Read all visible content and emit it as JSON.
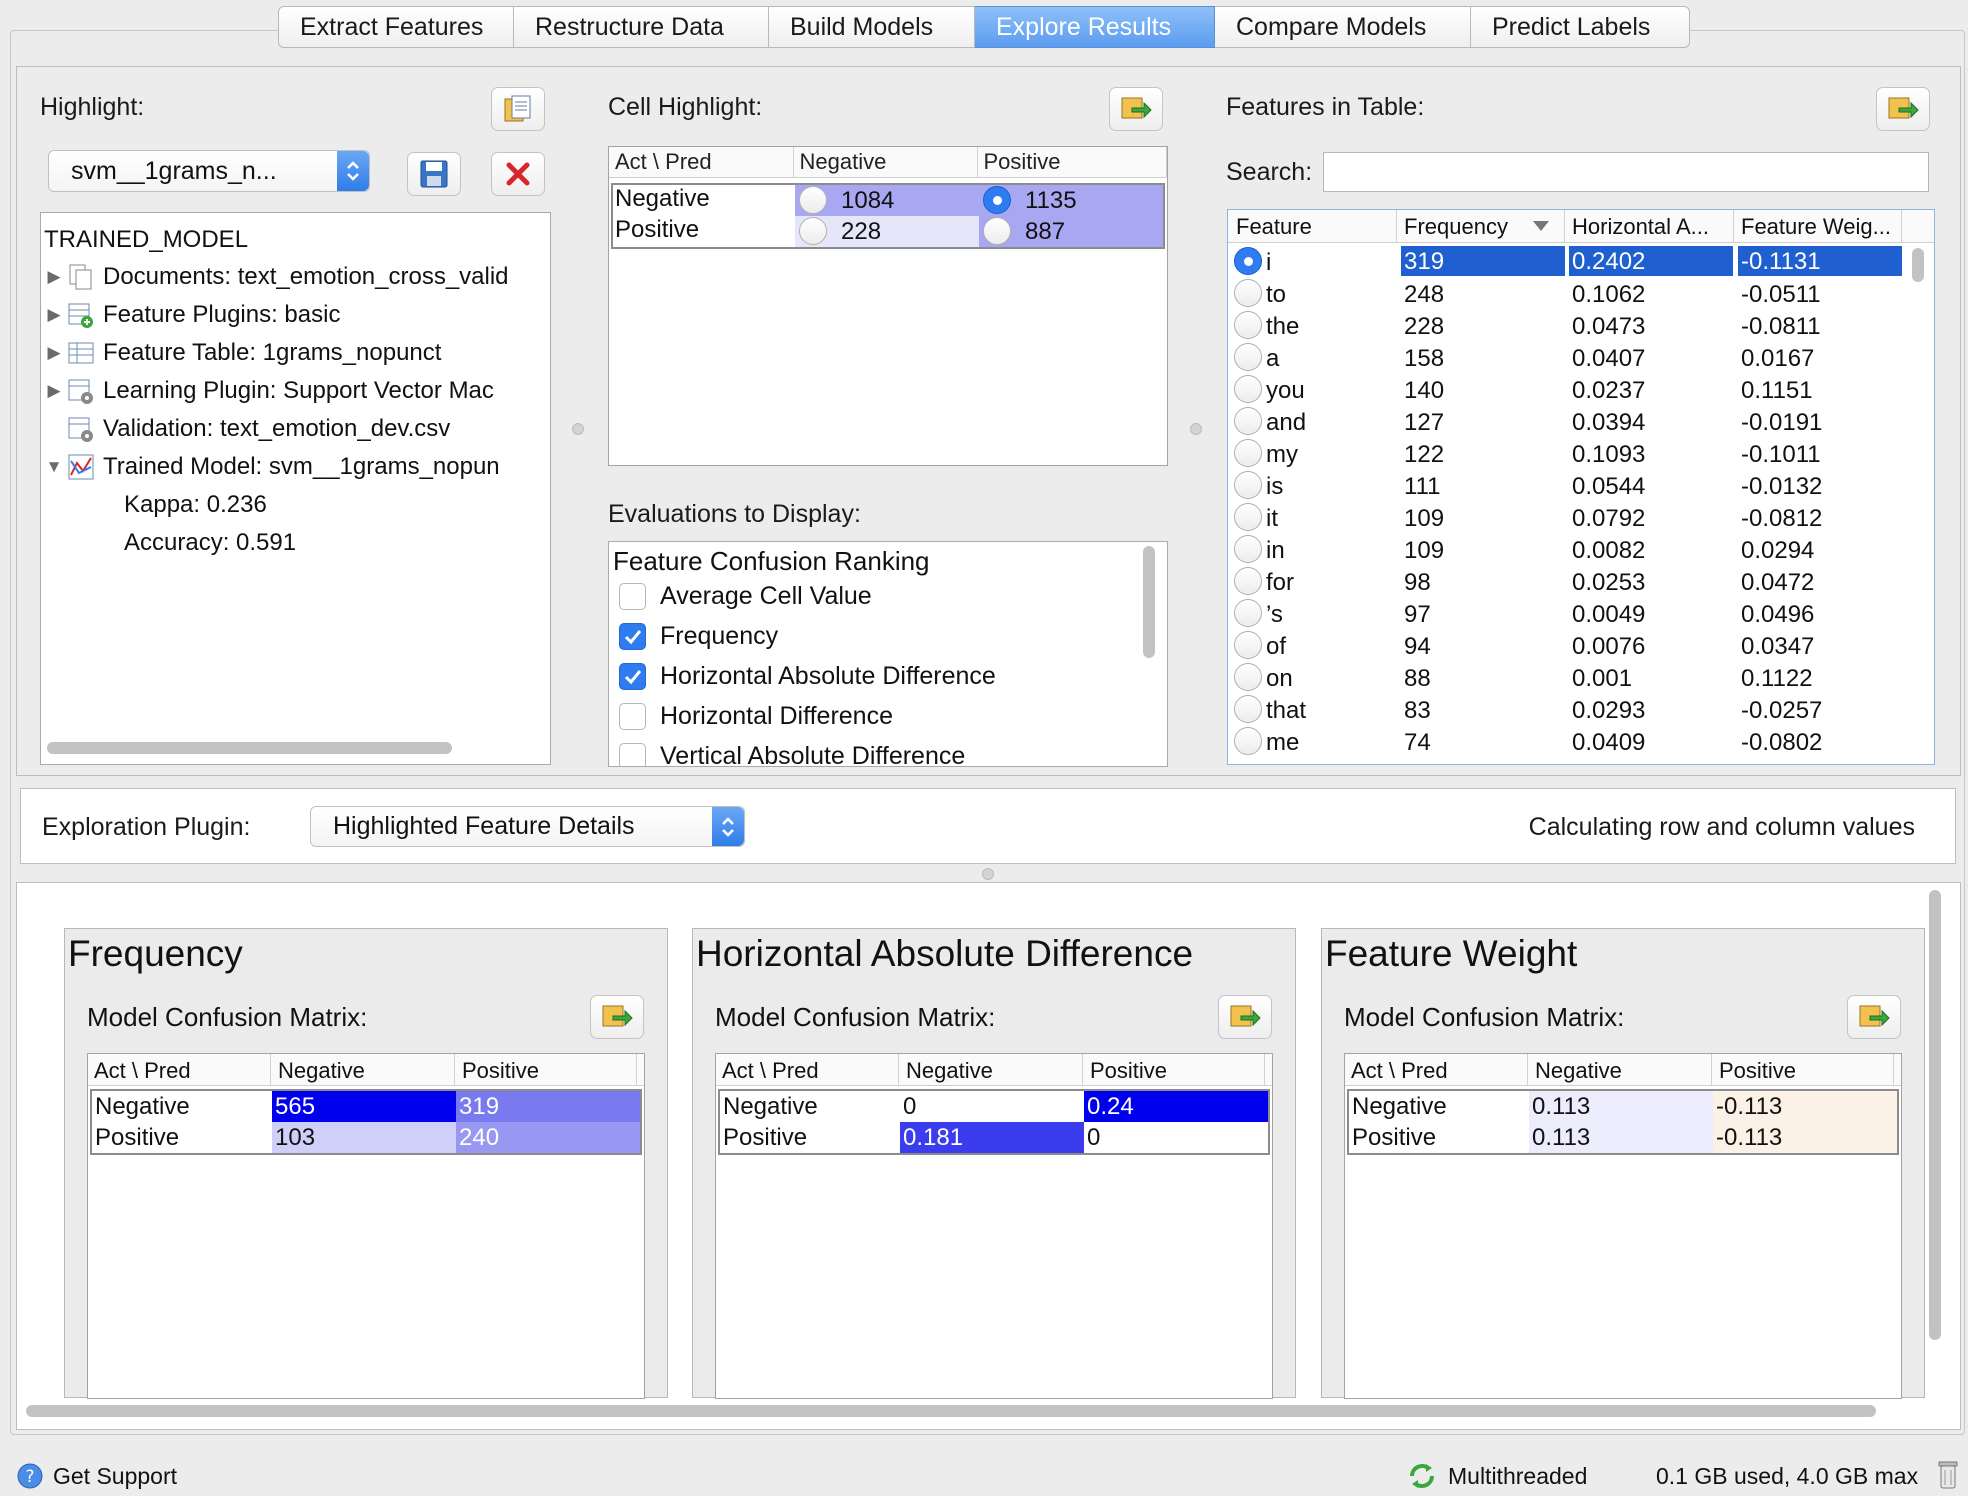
{
  "tabs": [
    "Extract Features",
    "Restructure Data",
    "Build Models",
    "Explore Results",
    "Compare Models",
    "Predict Labels"
  ],
  "active_tab": "Explore Results",
  "highlight": {
    "label": "Highlight:",
    "model_select": "svm__1grams_n...",
    "tree_root": "TRAINED_MODEL",
    "tree_items": [
      {
        "text": "Documents: text_emotion_cross_valid",
        "expandable": true
      },
      {
        "text": "Feature Plugins: basic",
        "expandable": true
      },
      {
        "text": "Feature Table: 1grams_nopunct",
        "expandable": true
      },
      {
        "text": "Learning Plugin:  Support Vector Mac",
        "expandable": true
      },
      {
        "text": "Validation: text_emotion_dev.csv",
        "expandable": false
      },
      {
        "text": "Trained Model: svm__1grams_nopun",
        "expandable": true,
        "expanded": true
      }
    ],
    "tree_children": [
      "Kappa: 0.236",
      "Accuracy: 0.591"
    ]
  },
  "cell_highlight": {
    "label": "Cell Highlight:",
    "headers": [
      "Act \\ Pred",
      "Negative",
      "Positive"
    ],
    "rows": [
      {
        "label": "Negative",
        "neg": "1084",
        "pos": "1135"
      },
      {
        "label": "Positive",
        "neg": "228",
        "pos": "887"
      }
    ]
  },
  "evaluations": {
    "label": "Evaluations to Display:",
    "title": "Feature Confusion Ranking",
    "items": [
      {
        "label": "Average Cell Value",
        "checked": false
      },
      {
        "label": "Frequency",
        "checked": true
      },
      {
        "label": "Horizontal Absolute Difference",
        "checked": true
      },
      {
        "label": "Horizontal Difference",
        "checked": false
      },
      {
        "label": "Vertical Absolute Difference",
        "checked": false
      }
    ]
  },
  "features": {
    "label": "Features in Table:",
    "search_label": "Search:",
    "search_value": "",
    "headers": [
      "Feature",
      "Frequency",
      "Horizontal A...",
      "Feature Weig..."
    ],
    "rows": [
      [
        "i",
        "319",
        "0.2402",
        "-0.1131"
      ],
      [
        "to",
        "248",
        "0.1062",
        "-0.0511"
      ],
      [
        "the",
        "228",
        "0.0473",
        "-0.0811"
      ],
      [
        "a",
        "158",
        "0.0407",
        "0.0167"
      ],
      [
        "you",
        "140",
        "0.0237",
        "0.1151"
      ],
      [
        "and",
        "127",
        "0.0394",
        "-0.0191"
      ],
      [
        "my",
        "122",
        "0.1093",
        "-0.1011"
      ],
      [
        "is",
        "111",
        "0.0544",
        "-0.0132"
      ],
      [
        "it",
        "109",
        "0.0792",
        "-0.0812"
      ],
      [
        "in",
        "109",
        "0.0082",
        "0.0294"
      ],
      [
        "for",
        "98",
        "0.0253",
        "0.0472"
      ],
      [
        "’s",
        "97",
        "0.0049",
        "0.0496"
      ],
      [
        "of",
        "94",
        "0.0076",
        "0.0347"
      ],
      [
        "on",
        "88",
        "0.001",
        "0.1122"
      ],
      [
        "that",
        "83",
        "0.0293",
        "-0.0257"
      ],
      [
        "me",
        "74",
        "0.0409",
        "-0.0802"
      ]
    ]
  },
  "exploration": {
    "label": "Exploration Plugin:",
    "plugin": "Highlighted Feature Details",
    "status": "Calculating row and column values"
  },
  "panels": [
    {
      "title": "Frequency",
      "sub": "Model Confusion Matrix:",
      "headers": [
        "Act \\ Pred",
        "Negative",
        "Positive"
      ],
      "rows": [
        {
          "label": "Negative",
          "neg": "565",
          "pos": "319",
          "neg_color": "#0000ee",
          "pos_color": "#7a7af0"
        },
        {
          "label": "Positive",
          "neg": "103",
          "pos": "240",
          "neg_color": "#cfcff9",
          "pos_color": "#9898f3"
        }
      ]
    },
    {
      "title": "Horizontal Absolute Difference",
      "sub": "Model Confusion Matrix:",
      "headers": [
        "Act \\ Pred",
        "Negative",
        "Positive"
      ],
      "rows": [
        {
          "label": "Negative",
          "neg": "0",
          "pos": "0.24",
          "neg_color": "#ffffff",
          "pos_color": "#0000ee"
        },
        {
          "label": "Positive",
          "neg": "0.181",
          "pos": "0",
          "neg_color": "#3c3cef",
          "pos_color": "#ffffff"
        }
      ]
    },
    {
      "title": "Feature Weight",
      "sub": "Model Confusion Matrix:",
      "headers": [
        "Act \\ Pred",
        "Negative",
        "Positive"
      ],
      "rows": [
        {
          "label": "Negative",
          "neg": "0.113",
          "pos": "-0.113",
          "neg_color": "#ececfc",
          "pos_color": "#fcf1e6"
        },
        {
          "label": "Positive",
          "neg": "0.113",
          "pos": "-0.113",
          "neg_color": "#ececfc",
          "pos_color": "#fcf1e6"
        }
      ]
    }
  ],
  "statusbar": {
    "support": "Get Support",
    "threading": "Multithreaded",
    "memory": "0.1 GB used, 4.0 GB max"
  },
  "colors": {
    "accent": "#2e7cf0",
    "selection": "#1f5fd0",
    "cell_highlight": "#a7a7f2",
    "cell_highlight_light": "#e6e6fb"
  }
}
